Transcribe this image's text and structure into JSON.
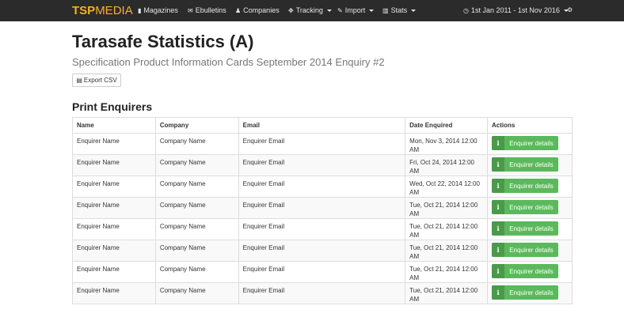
{
  "brand": {
    "part1": "TSP",
    "part2": "MEDIA"
  },
  "nav": {
    "magazines": "Magazines",
    "ebulletins": "Ebulletins",
    "companies": "Companies",
    "tracking": "Tracking",
    "import": "Import",
    "stats": "Stats",
    "daterange": "1st Jan 2011 - 1st Nov 2016"
  },
  "page": {
    "title": "Tarasafe Statistics (A)",
    "subtitle": "Specification Product Information Cards September 2014 Enquiry #2",
    "export_label": "Export CSV",
    "section_title": "Print Enquirers"
  },
  "table": {
    "headers": [
      "Name",
      "Company",
      "Email",
      "Date Enquired",
      "Actions"
    ],
    "rows": [
      {
        "name": "Enquirer Name",
        "company": "Company Name",
        "email": "Enquirer Email",
        "date": "Mon, Nov 3, 2014 12:00 AM",
        "action": "Enquirer details"
      },
      {
        "name": "Enquirer Name",
        "company": "Company Name",
        "email": "Enquirer Email",
        "date": "Fri, Oct 24, 2014 12:00 AM",
        "action": "Enquirer details"
      },
      {
        "name": "Enquirer Name",
        "company": "Company Name",
        "email": "Enquirer Email",
        "date": "Wed, Oct 22, 2014 12:00 AM",
        "action": "Enquirer details"
      },
      {
        "name": "Enquirer Name",
        "company": "Company Name",
        "email": "Enquirer Email",
        "date": "Tue, Oct 21, 2014 12:00 AM",
        "action": "Enquirer details"
      },
      {
        "name": "Enquirer Name",
        "company": "Company Name",
        "email": "Enquirer Email",
        "date": "Tue, Oct 21, 2014 12:00 AM",
        "action": "Enquirer details"
      },
      {
        "name": "Enquirer Name",
        "company": "Company Name",
        "email": "Enquirer Email",
        "date": "Tue, Oct 21, 2014 12:00 AM",
        "action": "Enquirer details"
      },
      {
        "name": "Enquirer Name",
        "company": "Company Name",
        "email": "Enquirer Email",
        "date": "Tue, Oct 21, 2014 12:00 AM",
        "action": "Enquirer details"
      },
      {
        "name": "Enquirer Name",
        "company": "Company Name",
        "email": "Enquirer Email",
        "date": "Tue, Oct 21, 2014 12:00 AM",
        "action": "Enquirer details"
      }
    ]
  },
  "colors": {
    "navbar": "#2b2b2b",
    "brand": "#f0b323",
    "success": "#5cb85c"
  },
  "icons": {
    "magazines": "book-icon",
    "ebulletins": "envelope-icon",
    "companies": "users-icon",
    "tracking": "move-icon",
    "import": "wrench-icon",
    "stats": "bar-chart-icon",
    "daterange": "clock-icon",
    "settings": "gear-icon",
    "export": "file-icon",
    "details": "info-icon"
  }
}
